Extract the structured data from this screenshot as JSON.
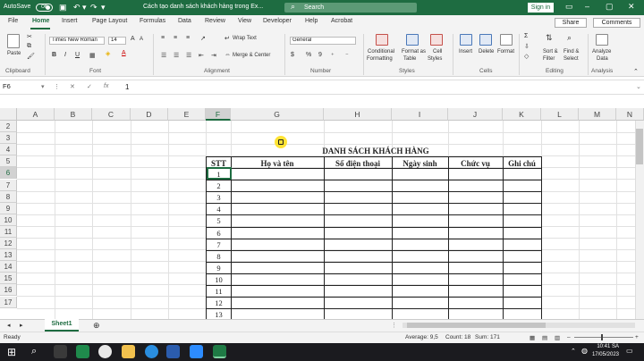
{
  "titlebar": {
    "autosave": "AutoSave",
    "toggle": "Off",
    "doc_title": "Cách tạo danh sách khách hàng trong Ex...",
    "search_placeholder": "Search",
    "signin": "Sign in"
  },
  "menu": [
    "File",
    "Home",
    "Insert",
    "Page Layout",
    "Formulas",
    "Data",
    "Review",
    "View",
    "Developer",
    "Help",
    "Acrobat"
  ],
  "menu_right": {
    "share": "Share",
    "comments": "Comments"
  },
  "ribbon": {
    "clipboard": {
      "paste": "Paste",
      "group": "Clipboard"
    },
    "font": {
      "name": "Times New Roman",
      "size": "14",
      "group": "Font"
    },
    "alignment": {
      "wrap": "Wrap Text",
      "merge": "Merge & Center",
      "group": "Alignment"
    },
    "number": {
      "format": "General",
      "dollar": "$",
      "percent": "%",
      "comma": "9",
      "group": "Number"
    },
    "styles": {
      "cond1": "Conditional",
      "cond2": "Formatting",
      "fmt1": "Format as",
      "fmt2": "Table",
      "cell1": "Cell",
      "cell2": "Styles",
      "group": "Styles"
    },
    "cells": {
      "insert": "Insert",
      "delete": "Delete",
      "format": "Format",
      "group": "Cells"
    },
    "editing": {
      "sort1": "Sort &",
      "sort2": "Filter",
      "find1": "Find &",
      "find2": "Select",
      "group": "Editing"
    },
    "analysis": {
      "a1": "Analyze",
      "a2": "Data",
      "group": "Analysis"
    }
  },
  "formula_bar": {
    "namebox": "F6",
    "x": "✕",
    "check": "✓",
    "fx": "fx",
    "value": "1"
  },
  "columns": [
    "A",
    "B",
    "C",
    "D",
    "E",
    "F",
    "G",
    "H",
    "I",
    "J",
    "K",
    "L",
    "M",
    "N"
  ],
  "rows": [
    "2",
    "3",
    "4",
    "5",
    "6",
    "7",
    "8",
    "9",
    "10",
    "11",
    "12",
    "13",
    "14",
    "15",
    "16",
    "17"
  ],
  "sheet_title": "DANH SÁCH KHÁCH HÀNG",
  "table_headers": [
    "STT",
    "Họ và tên",
    "Số điện thoại",
    "Ngày sinh",
    "Chức vụ",
    "Ghi chú"
  ],
  "stt_values": [
    "1",
    "2",
    "3",
    "4",
    "5",
    "6",
    "7",
    "8",
    "9",
    "10",
    "11",
    "12",
    "13"
  ],
  "sheet_tab": "Sheet1",
  "status": {
    "ready": "Ready",
    "average": "Average: 9,5",
    "count": "Count: 18",
    "sum": "Sum: 171"
  },
  "taskbar": {
    "time": "10:41 SA",
    "date": "17/05/2023"
  }
}
